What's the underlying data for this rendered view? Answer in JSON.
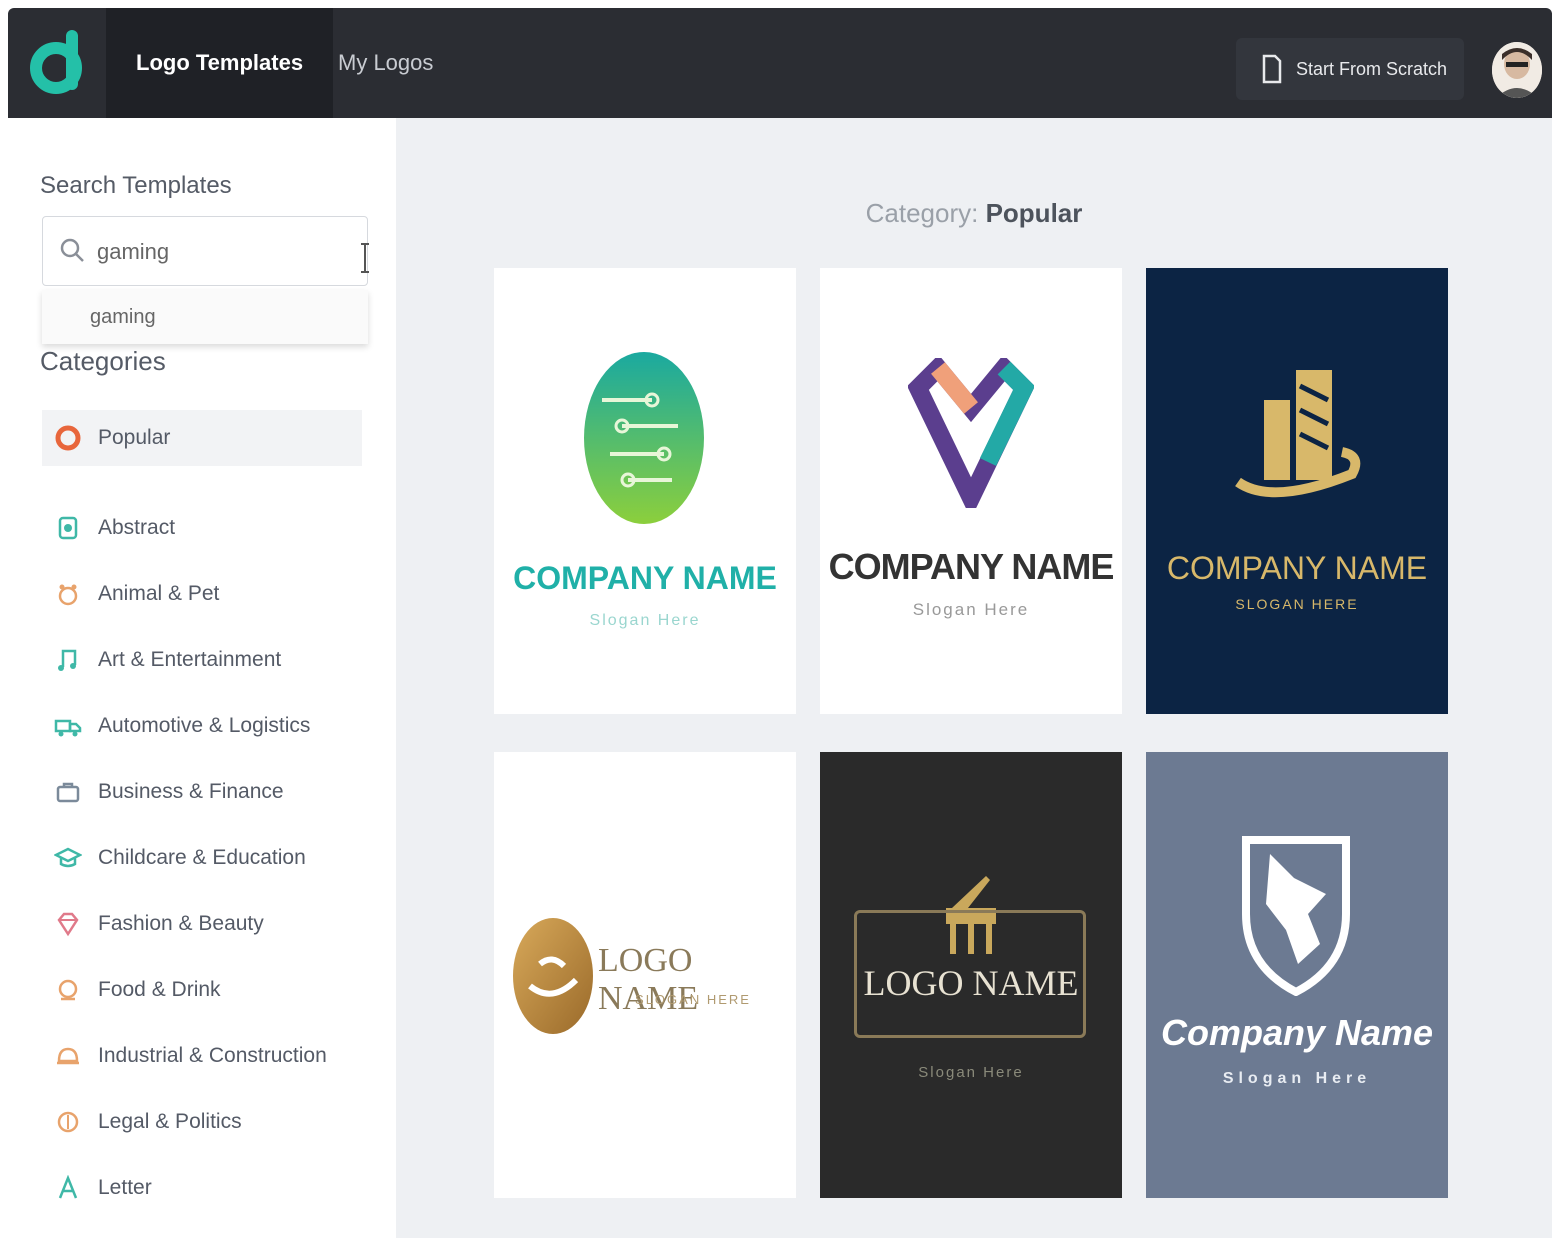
{
  "header": {
    "tabs": [
      {
        "label": "Logo Templates",
        "active": true
      },
      {
        "label": "My Logos",
        "active": false
      }
    ],
    "start_button_label": "Start From Scratch"
  },
  "sidebar": {
    "search_label": "Search Templates",
    "search_value": "gaming",
    "suggestions": [
      "gaming"
    ],
    "categories_label": "Categories",
    "categories": [
      {
        "label": "Popular",
        "icon": "circle-badge-icon",
        "color": "#e8663c",
        "active": true
      },
      {
        "label": "Abstract",
        "icon": "abstract-icon",
        "color": "#3fb8a7"
      },
      {
        "label": "Animal & Pet",
        "icon": "paw-icon",
        "color": "#e8a36c"
      },
      {
        "label": "Art & Entertainment",
        "icon": "music-note-icon",
        "color": "#3fb8a7"
      },
      {
        "label": "Automotive & Logistics",
        "icon": "truck-icon",
        "color": "#3fb8a7"
      },
      {
        "label": "Business & Finance",
        "icon": "briefcase-icon",
        "color": "#7b8a9a"
      },
      {
        "label": "Childcare & Education",
        "icon": "graduation-cap-icon",
        "color": "#3fb8a7"
      },
      {
        "label": "Fashion & Beauty",
        "icon": "diamond-icon",
        "color": "#e07a8a"
      },
      {
        "label": "Food & Drink",
        "icon": "food-icon",
        "color": "#e8a36c"
      },
      {
        "label": "Industrial & Construction",
        "icon": "helmet-icon",
        "color": "#e8a36c"
      },
      {
        "label": "Legal & Politics",
        "icon": "scales-icon",
        "color": "#e8a36c"
      },
      {
        "label": "Letter",
        "icon": "letter-icon",
        "color": "#3fb8a7"
      }
    ]
  },
  "main": {
    "category_prefix": "Category:",
    "category_name": "Popular",
    "templates": [
      {
        "title": "COMPANY NAME",
        "slogan": "Slogan Here",
        "bg": "#ffffff",
        "accent": "#20b0a8"
      },
      {
        "title": "COMPANY NAME",
        "slogan": "Slogan Here",
        "bg": "#ffffff",
        "accent": "#333333"
      },
      {
        "title": "COMPANY NAME",
        "slogan": "SLOGAN HERE",
        "bg": "#0c2444",
        "accent": "#d8b86a"
      },
      {
        "title": "LOGO NAME",
        "slogan": "SLOGAN HERE",
        "bg": "#ffffff",
        "accent": "#b8893c"
      },
      {
        "title": "LOGO NAME",
        "slogan": "Slogan Here",
        "bg": "#2a2a2a",
        "accent": "#c9a85c"
      },
      {
        "title": "Company Name",
        "slogan": "Slogan Here",
        "bg": "#6c7a92",
        "accent": "#ffffff"
      }
    ]
  }
}
